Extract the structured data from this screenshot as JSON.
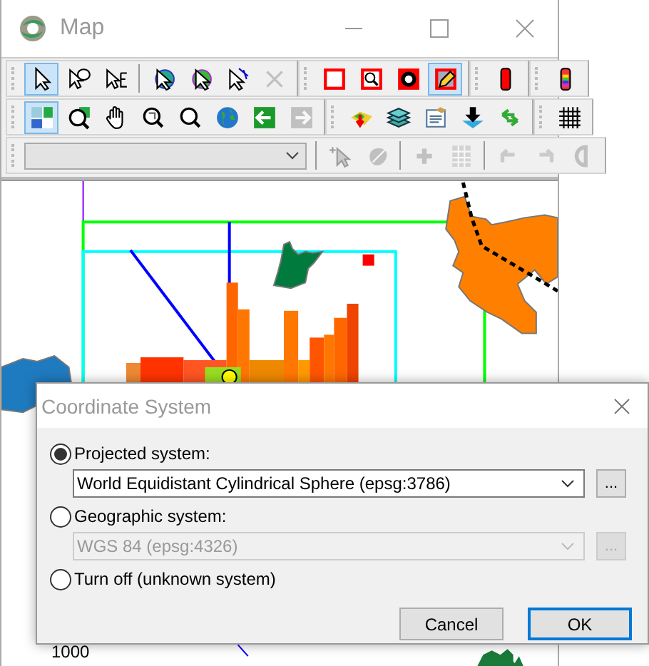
{
  "map_window": {
    "title": "Map",
    "toolbars": [
      {
        "groups": [
          {
            "kind": "tools",
            "sections": [
              [
                {
                  "selected": true,
                  "disabled": false
                },
                {
                  "selected": false,
                  "disabled": false
                },
                {
                  "selected": false,
                  "disabled": false
                }
              ],
              [
                {
                  "selected": false,
                  "disabled": false
                },
                {
                  "selected": false,
                  "disabled": false
                },
                {
                  "selected": false,
                  "disabled": false
                },
                {
                  "selected": false,
                  "disabled": true
                }
              ]
            ]
          },
          {
            "kind": "tools",
            "sections": [
              [
                {
                  "selected": false,
                  "disabled": false
                },
                {
                  "selected": false,
                  "disabled": false
                },
                {
                  "selected": false,
                  "disabled": false
                },
                {
                  "selected": true,
                  "disabled": false
                }
              ]
            ]
          },
          {
            "kind": "tools",
            "sections": [
              [
                {
                  "selected": false,
                  "disabled": false
                }
              ]
            ]
          },
          {
            "kind": "tools",
            "sections": [
              [
                {
                  "selected": false,
                  "disabled": false
                }
              ]
            ]
          }
        ]
      },
      {
        "groups": [
          {
            "kind": "tools",
            "sections": [
              [
                {
                  "selected": true,
                  "disabled": false
                },
                {
                  "selected": false,
                  "disabled": false
                },
                {
                  "selected": false,
                  "disabled": false
                },
                {
                  "selected": false,
                  "disabled": false
                },
                {
                  "selected": false,
                  "disabled": false
                },
                {
                  "selected": false,
                  "disabled": false
                },
                {
                  "selected": false,
                  "disabled": false
                },
                {
                  "selected": false,
                  "disabled": true
                }
              ]
            ]
          },
          {
            "kind": "tools",
            "sections": [
              [
                {
                  "selected": false,
                  "disabled": false
                },
                {
                  "selected": false,
                  "disabled": false
                },
                {
                  "selected": false,
                  "disabled": false
                },
                {
                  "selected": false,
                  "disabled": false
                },
                {
                  "selected": false,
                  "disabled": false
                }
              ]
            ]
          },
          {
            "kind": "tools",
            "sections": [
              [
                {
                  "selected": false,
                  "disabled": false
                }
              ]
            ]
          }
        ]
      },
      {
        "groups": [
          {
            "kind": "combo",
            "sections": [
              [
                {
                  "selected": false,
                  "disabled": true
                },
                {
                  "selected": false,
                  "disabled": true
                }
              ],
              [
                {
                  "selected": false,
                  "disabled": true
                },
                {
                  "selected": false,
                  "disabled": true
                }
              ],
              [
                {
                  "selected": false,
                  "disabled": true
                },
                {
                  "selected": false,
                  "disabled": true
                },
                {
                  "selected": false,
                  "disabled": true
                }
              ]
            ]
          }
        ]
      }
    ],
    "scale_label": "1000"
  },
  "dialog": {
    "title": "Coordinate System",
    "options": [
      {
        "label": "Projected system:",
        "selected": true,
        "value": "World Equidistant Cylindrical Sphere (epsg:3786)",
        "browse": "...",
        "disabled": false
      },
      {
        "label": "Geographic system:",
        "selected": false,
        "value": "WGS 84 (epsg:4326)",
        "browse": "...",
        "disabled": true
      },
      {
        "label": "Turn off (unknown system)",
        "selected": false
      }
    ],
    "buttons": [
      {
        "label": "Cancel",
        "default": false
      },
      {
        "label": "OK",
        "default": true
      }
    ]
  }
}
